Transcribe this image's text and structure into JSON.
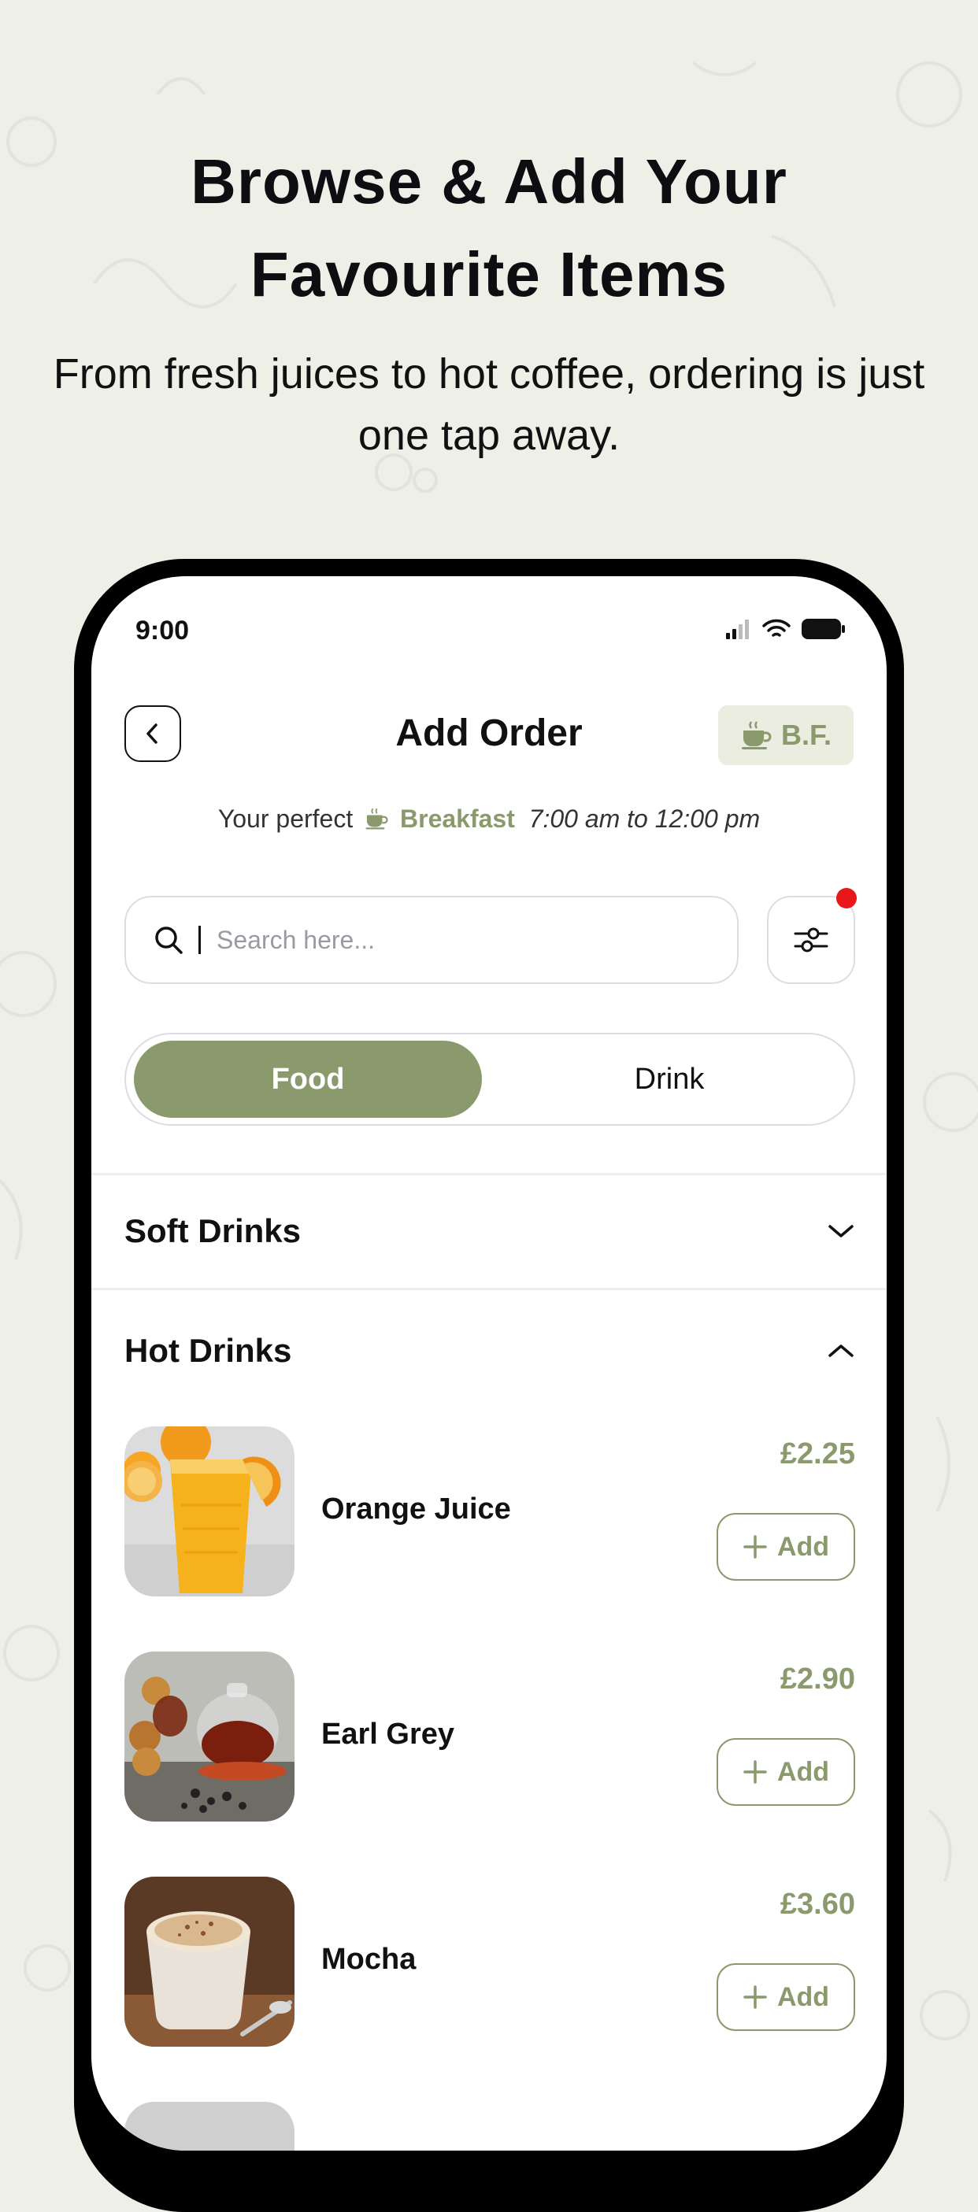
{
  "hero": {
    "title_line1": "Browse & Add Your",
    "title_line2": "Favourite Items",
    "subtitle": "From fresh juices to hot coffee, ordering is just one tap away."
  },
  "status_bar": {
    "time": "9:00",
    "icons": [
      "cellular-signal-icon",
      "wifi-icon",
      "battery-icon"
    ]
  },
  "header": {
    "back_icon": "chevron-left-icon",
    "title": "Add Order",
    "badge_icon": "coffee-cup-icon",
    "badge_label": "B.F."
  },
  "meal_info": {
    "prefix": "Your perfect",
    "meal": "Breakfast",
    "hours": "7:00 am to 12:00 pm"
  },
  "search": {
    "placeholder": "Search here...",
    "value": "",
    "filter_has_notification": true
  },
  "tabs": {
    "selected": "Food",
    "items": [
      "Food",
      "Drink"
    ]
  },
  "sections": [
    {
      "title": "Soft Drinks",
      "expanded": false
    },
    {
      "title": "Hot Drinks",
      "expanded": true
    }
  ],
  "items": [
    {
      "name": "Orange Juice",
      "price": "£2.25",
      "add_label": "Add",
      "image": "orange-juice-photo"
    },
    {
      "name": "Earl Grey",
      "price": "£2.90",
      "add_label": "Add",
      "image": "earl-grey-tea-photo"
    },
    {
      "name": "Mocha",
      "price": "£3.60",
      "add_label": "Add",
      "image": "mocha-photo"
    }
  ],
  "colors": {
    "background": "#eef0e8",
    "accent": "#8a9a6c",
    "badge_bg": "#eaede0",
    "notification": "#e8171a",
    "phone_frame": "#000000"
  }
}
